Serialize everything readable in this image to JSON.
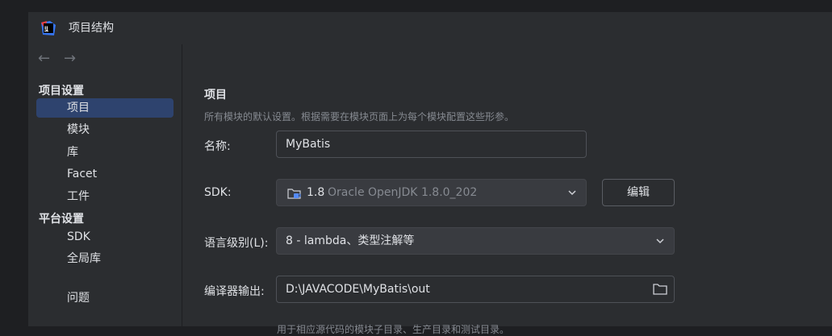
{
  "window": {
    "title": "项目结构"
  },
  "colors": {
    "accent": "#2e436e",
    "background": "#2b2d30",
    "logo_primary": "#3574f0",
    "logo_secondary": "#f04040"
  },
  "nav": {
    "back_icon": "arrow-left-icon",
    "forward_icon": "arrow-right-icon"
  },
  "sidebar": {
    "section_project": "项目设置",
    "project_items": [
      {
        "label": "项目",
        "selected": true
      },
      {
        "label": "模块"
      },
      {
        "label": "库"
      },
      {
        "label": "Facet"
      },
      {
        "label": "工件"
      }
    ],
    "section_platform": "平台设置",
    "platform_items": [
      {
        "label": "SDK"
      },
      {
        "label": "全局库"
      }
    ],
    "problems": "问题"
  },
  "main": {
    "heading": "项目",
    "description": "所有模块的默认设置。根据需要在模块页面上为每个模块配置这些形参。",
    "name_label": "名称:",
    "name_value": "MyBatis",
    "sdk_label": "SDK:",
    "sdk_version": "1.8",
    "sdk_detail": "Oracle OpenJDK 1.8.0_202",
    "sdk_edit_button": "编辑",
    "language_level_label": "语言级别(L):",
    "language_level_value": "8 - lambda、类型注解等",
    "compiler_output_label": "编译器输出:",
    "compiler_output_value": "D:\\JAVACODE\\MyBatis\\out",
    "compiler_output_hint": "用于相应源代码的模块子目录、生产目录和测试目录。"
  }
}
